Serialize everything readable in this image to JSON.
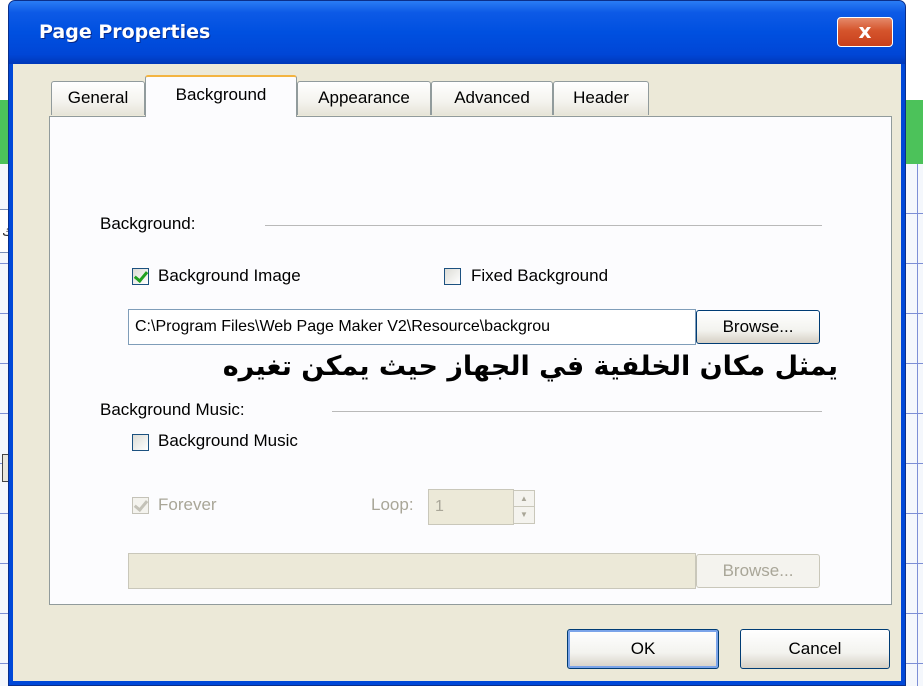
{
  "background_app": {
    "field_text": "اك",
    "combo_arrow": "▼"
  },
  "dialog": {
    "title": "Page Properties",
    "close_glyph": "x"
  },
  "tabs": [
    {
      "label": "General",
      "active": false
    },
    {
      "label": "Background",
      "active": true
    },
    {
      "label": "Appearance",
      "active": false
    },
    {
      "label": "Advanced",
      "active": false
    },
    {
      "label": "Header",
      "active": false
    }
  ],
  "background_group": {
    "title": "Background:",
    "background_image": {
      "label": "Background Image",
      "checked": true
    },
    "fixed_background": {
      "label": "Fixed Background",
      "checked": false
    },
    "path_value": "C:\\Program Files\\Web Page Maker V2\\Resource\\backgrou",
    "browse_label": "Browse..."
  },
  "annotation": "يمثل مكان الخلفية في الجهاز حيث يمكن تغيره",
  "music_group": {
    "title": "Background Music:",
    "background_music": {
      "label": "Background Music",
      "checked": false
    },
    "forever": {
      "label": "Forever",
      "checked": true,
      "disabled": true
    },
    "loop_label": "Loop:",
    "loop_value": "1",
    "music_path_value": "",
    "browse_label": "Browse..."
  },
  "footer": {
    "ok_label": "OK",
    "cancel_label": "Cancel"
  },
  "colors": {
    "titlebar": "#0050e0",
    "close_button": "#d5542c",
    "dialog_face": "#ece9d8",
    "active_tab_accent": "#f3b441",
    "check_mark": "#21a121"
  }
}
